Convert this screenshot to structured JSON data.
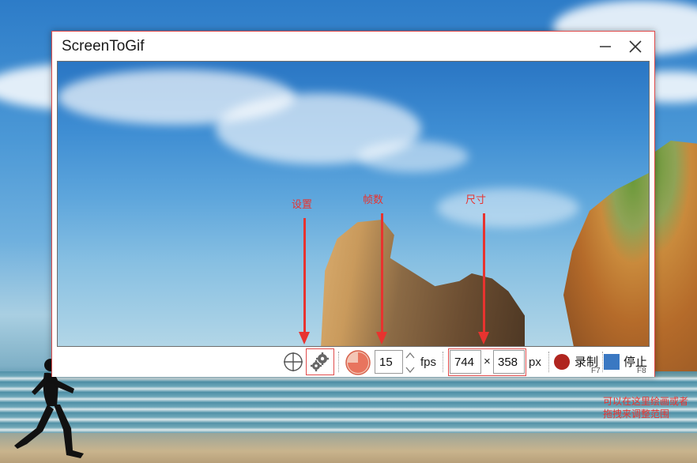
{
  "window": {
    "title": "ScreenToGif",
    "minimize_icon": "minimize-icon",
    "close_icon": "close-icon"
  },
  "annotations": {
    "settings": "设置",
    "frame_rate": "帧数",
    "size": "尺寸",
    "note": "可以在这里绘画或者拖拽来调整范围"
  },
  "toolbar": {
    "crosshair_icon": "crosshair-icon",
    "settings_icon": "gear-icon",
    "fps_icon": "pie-timer-icon",
    "fps_value": "15",
    "fps_unit": "fps",
    "width_value": "744",
    "times_sign": "×",
    "height_value": "358",
    "size_unit": "px",
    "record_label": "录制",
    "record_hotkey": "F7",
    "stop_label": "停止",
    "stop_hotkey": "F8"
  },
  "colors": {
    "annotation_red": "#e8332f",
    "record_red": "#b0251f",
    "stop_blue": "#3a78c2"
  }
}
